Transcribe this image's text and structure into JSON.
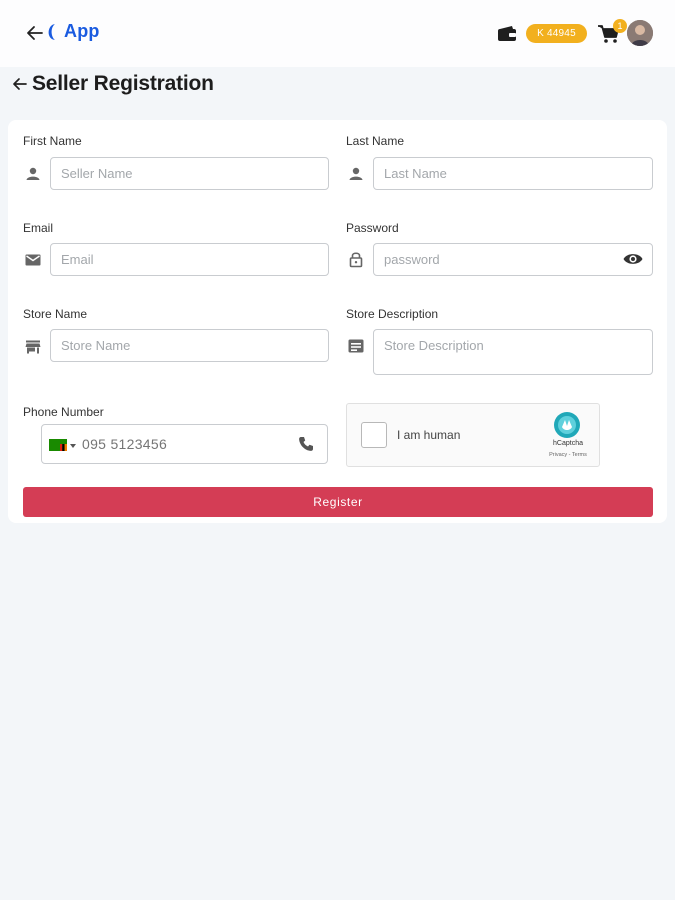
{
  "header": {
    "app_name": "App",
    "balance": "K 44945",
    "cart_count": "1",
    "icons": [
      "back-arrow-icon",
      "app-logo-icon",
      "wallet-icon",
      "cart-icon",
      "avatar"
    ]
  },
  "page": {
    "title": "Seller Registration"
  },
  "form": {
    "first_name": {
      "label": "First Name",
      "placeholder": "Seller Name",
      "value": ""
    },
    "last_name": {
      "label": "Last Name",
      "placeholder": "Last Name",
      "value": ""
    },
    "email": {
      "label": "Email",
      "placeholder": "Email",
      "value": ""
    },
    "password": {
      "label": "Password",
      "placeholder": "password",
      "value": ""
    },
    "store_name": {
      "label": "Store Name",
      "placeholder": "Store Name",
      "value": ""
    },
    "store_description": {
      "label": "Store Description",
      "placeholder": "Store Description",
      "value": ""
    },
    "phone": {
      "label": "Phone Number",
      "placeholder": "095 5123456",
      "value": ""
    },
    "register_label": "Register"
  },
  "captcha": {
    "label": "I am human",
    "brand": "hCaptcha",
    "links": "Privacy - Terms"
  },
  "colors": {
    "brand_blue": "#1a5be0",
    "badge_yellow": "#f2b01e",
    "register_red": "#d43d55",
    "page_bg": "#f3f6f9"
  }
}
